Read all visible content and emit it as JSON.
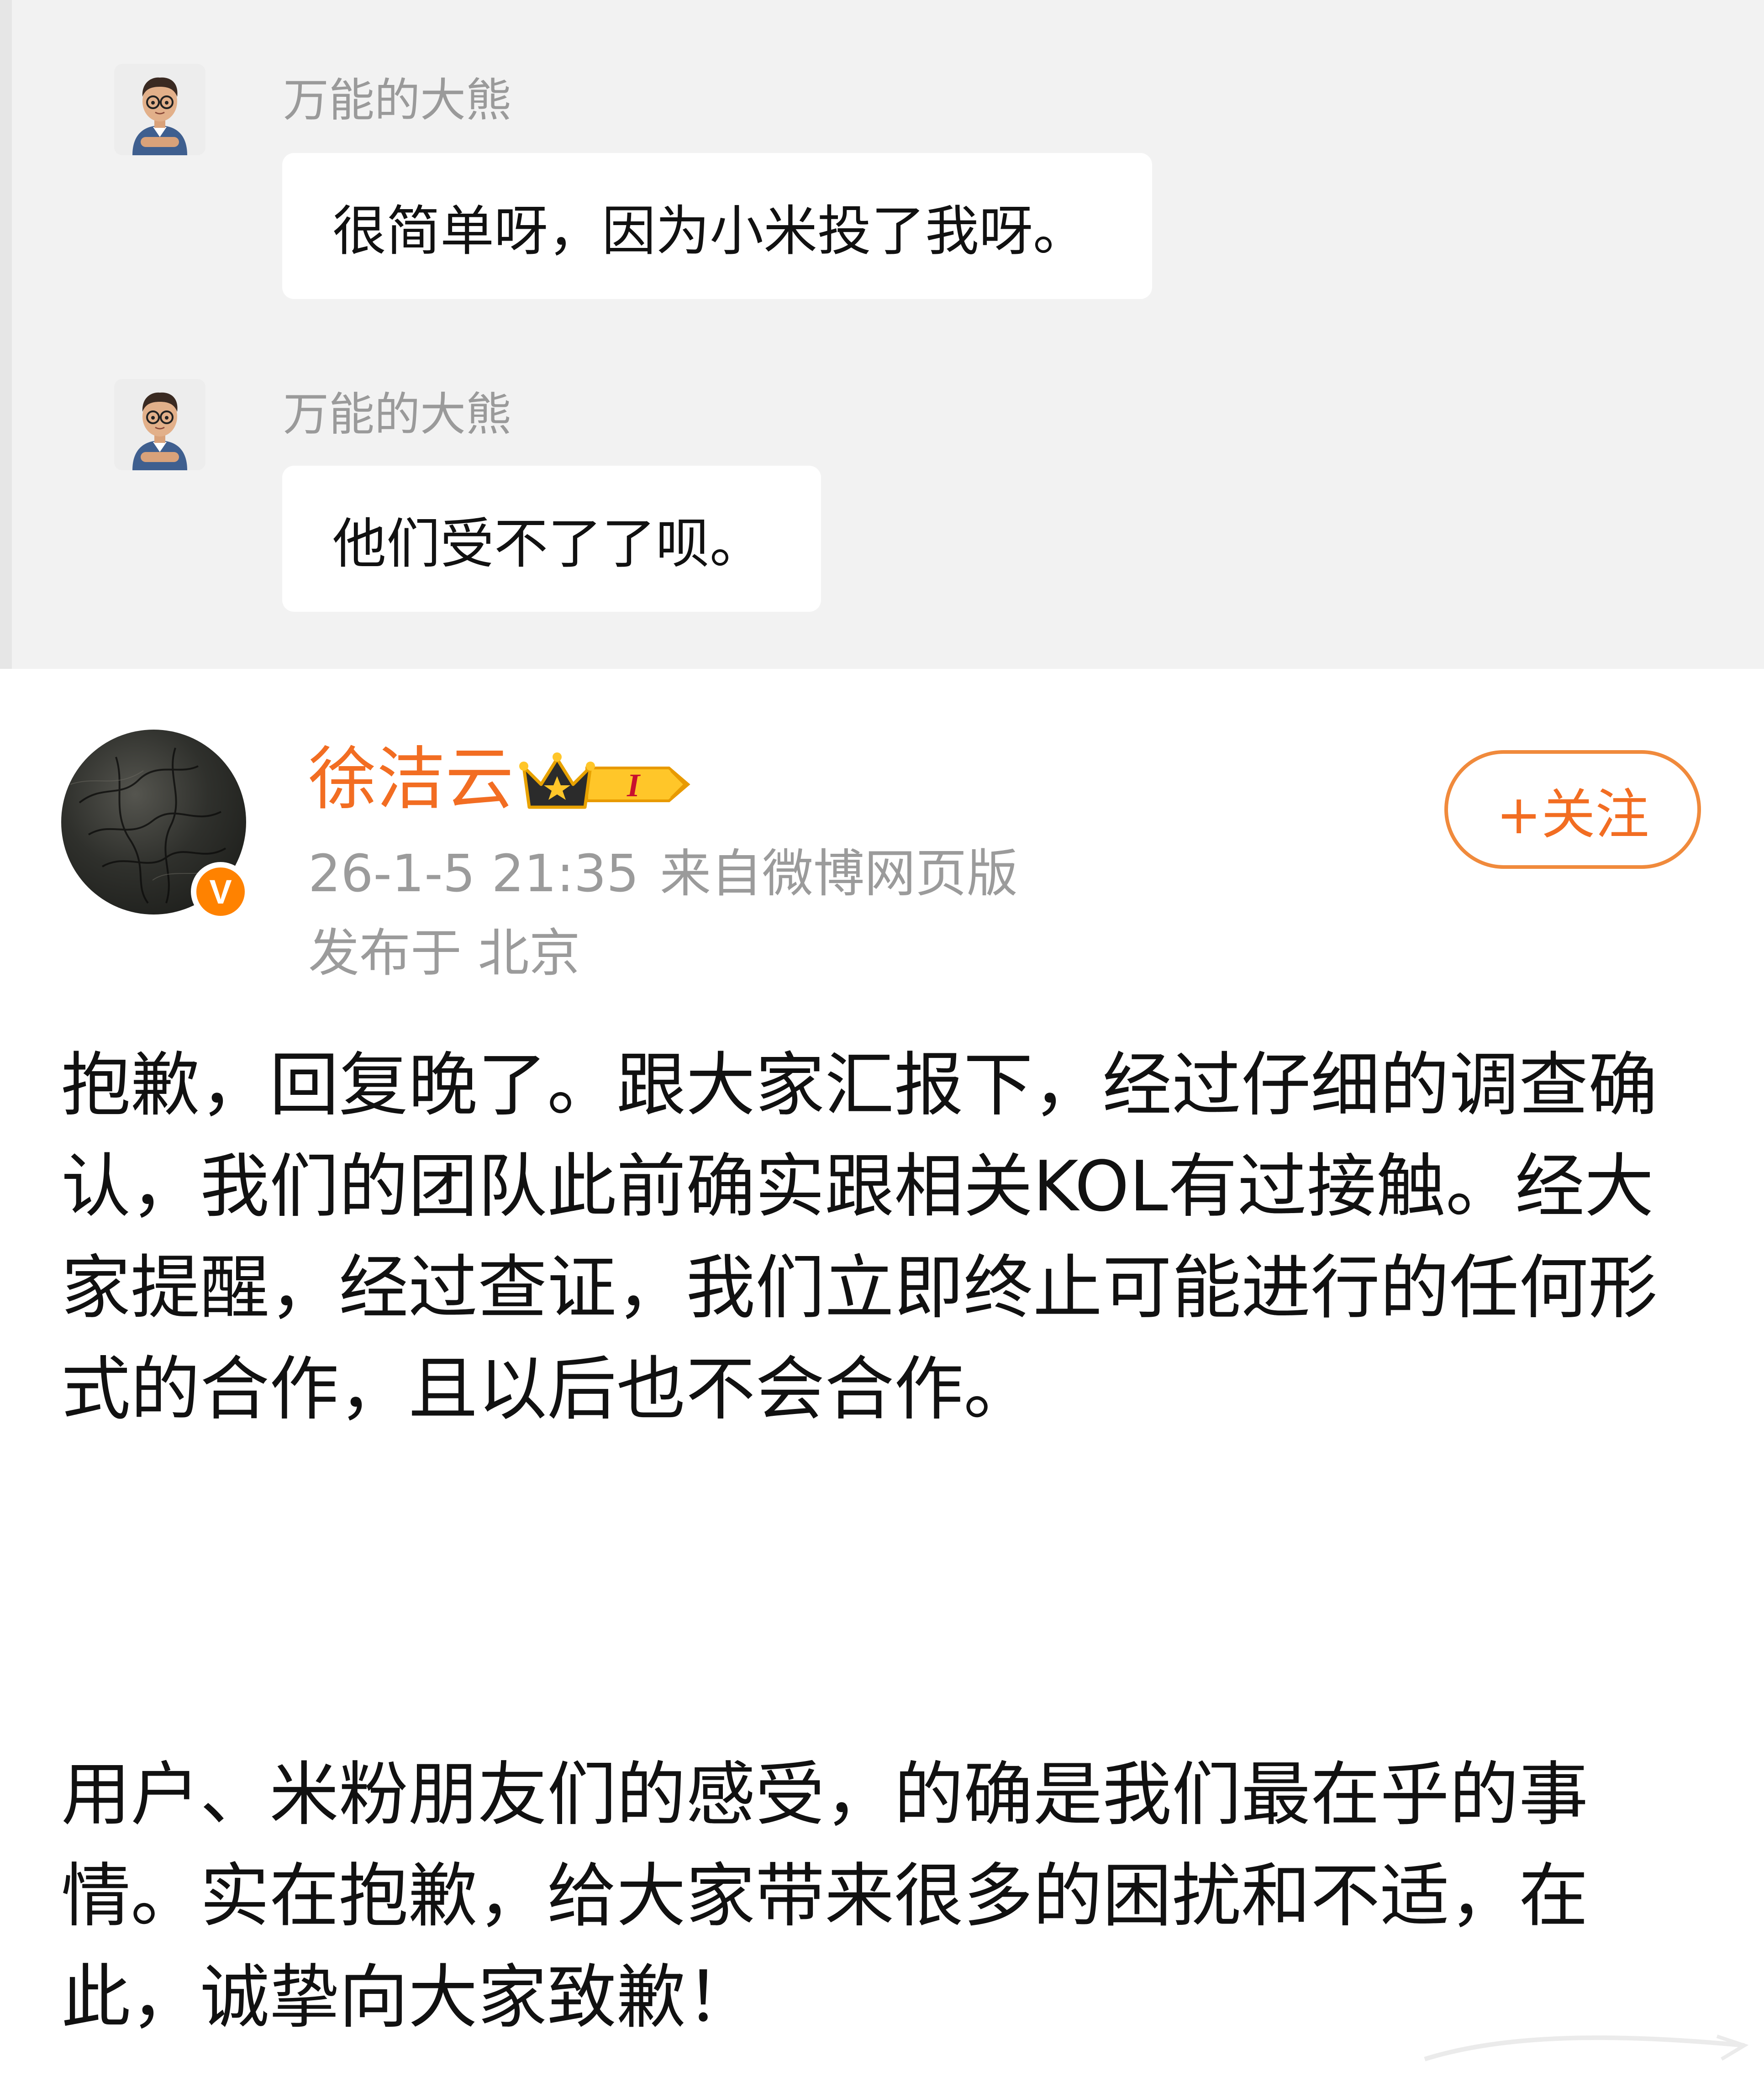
{
  "chat": {
    "messages": [
      {
        "sender": "万能的大熊",
        "text": "很简单呀，因为小米投了我呀。"
      },
      {
        "sender": "万能的大熊",
        "text": "他们受不了了呗。"
      }
    ]
  },
  "post": {
    "author": "徐洁云",
    "verified_mark": "V",
    "vip_level": "I",
    "time": "26-1-5 21:35",
    "source": "来自微博网页版",
    "location": "发布于 北京",
    "follow_label": "+关注",
    "paragraphs": [
      "抱歉，回复晚了。跟大家汇报下，经过仔细的调查确认，我们的团队此前确实跟相关KOL有过接触。经大家提醒，经过查证，我们立即终止可能进行的任何形式的合作，且以后也不会合作。",
      "用户、米粉朋友们的感受，的确是我们最在乎的事情。实在抱歉，给大家带来很多的困扰和不适，在此，诚挚向大家致歉！"
    ]
  },
  "colors": {
    "accent": "#f26d22",
    "badge": "#ff8200",
    "meta_text": "#9b9b9b",
    "chat_bg": "#f2f2f2"
  },
  "icons": {
    "chat_avatar": "memoji-avatar-icon",
    "vip": "crown-vip-icon",
    "verified": "verified-v-icon"
  }
}
